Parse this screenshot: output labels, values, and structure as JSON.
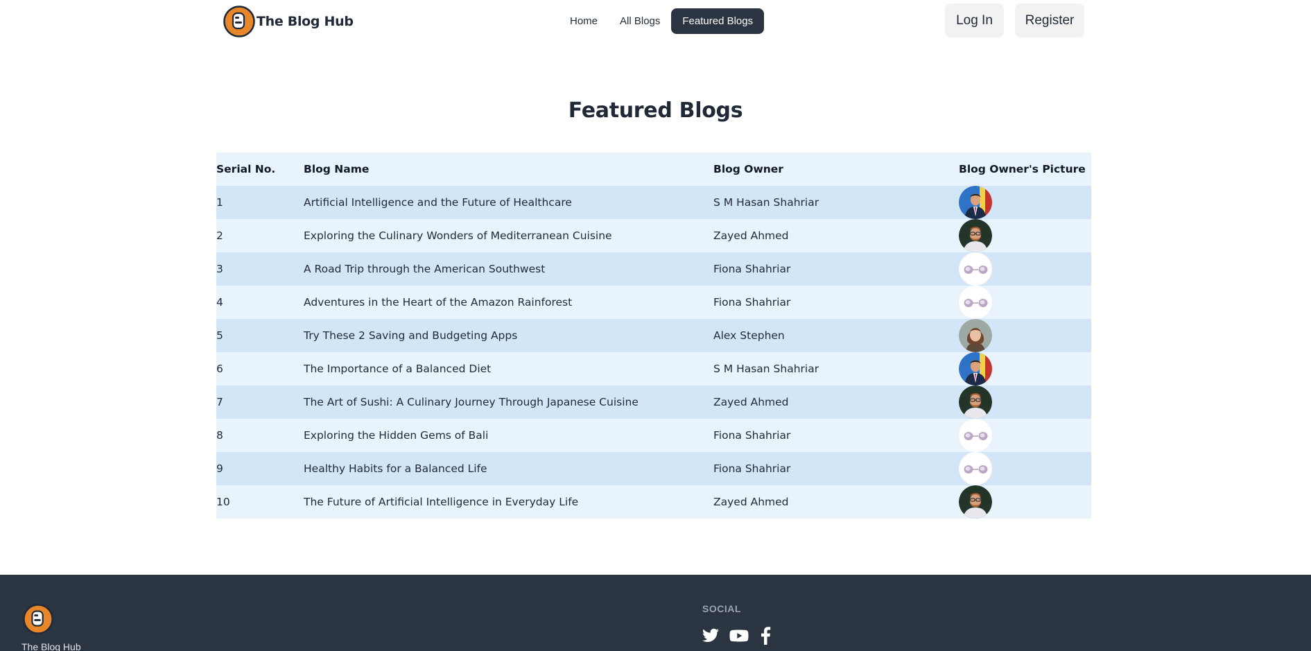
{
  "brand": {
    "name": "The Blog Hub"
  },
  "nav": {
    "links": [
      {
        "label": "Home"
      },
      {
        "label": "All Blogs"
      },
      {
        "label": "Featured Blogs"
      }
    ]
  },
  "auth": {
    "login_label": "Log In",
    "register_label": "Register"
  },
  "page": {
    "title": "Featured Blogs"
  },
  "table": {
    "headers": {
      "serial": "Serial No.",
      "name": "Blog Name",
      "owner": "Blog Owner",
      "picture": "Blog Owner's Picture"
    },
    "rows": [
      {
        "serial": "1",
        "name": "Artificial Intelligence and the Future of Healthcare",
        "owner": "S M Hasan Shahriar",
        "avatar": "hasan-avatar"
      },
      {
        "serial": "2",
        "name": "Exploring the Culinary Wonders of Mediterranean Cuisine",
        "owner": "Zayed Ahmed",
        "avatar": "zayed-avatar"
      },
      {
        "serial": "3",
        "name": "A Road Trip through the American Southwest",
        "owner": "Fiona Shahriar",
        "avatar": "fiona-avatar"
      },
      {
        "serial": "4",
        "name": "Adventures in the Heart of the Amazon Rainforest",
        "owner": "Fiona Shahriar",
        "avatar": "fiona-avatar"
      },
      {
        "serial": "5",
        "name": "Try These 2 Saving and Budgeting Apps",
        "owner": "Alex Stephen",
        "avatar": "alex-avatar"
      },
      {
        "serial": "6",
        "name": "The Importance of a Balanced Diet",
        "owner": "S M Hasan Shahriar",
        "avatar": "hasan-avatar"
      },
      {
        "serial": "7",
        "name": "The Art of Sushi: A Culinary Journey Through Japanese Cuisine",
        "owner": "Zayed Ahmed",
        "avatar": "zayed-avatar"
      },
      {
        "serial": "8",
        "name": "Exploring the Hidden Gems of Bali",
        "owner": "Fiona Shahriar",
        "avatar": "fiona-avatar"
      },
      {
        "serial": "9",
        "name": "Healthy Habits for a Balanced Life",
        "owner": "Fiona Shahriar",
        "avatar": "fiona-avatar"
      },
      {
        "serial": "10",
        "name": "The Future of Artificial Intelligence in Everyday Life",
        "owner": "Zayed Ahmed",
        "avatar": "zayed-avatar"
      }
    ]
  },
  "footer": {
    "brand": "The Blog Hub",
    "social_title": "SOCIAL",
    "social_icons": [
      "twitter-icon",
      "youtube-icon",
      "facebook-icon"
    ]
  },
  "colors": {
    "nav_active_bg": "#2b3441",
    "footer_bg": "#2b3441",
    "row_odd": "#d2e6f8",
    "row_even": "#e9f3fc",
    "logo_orange": "#e8862a"
  }
}
